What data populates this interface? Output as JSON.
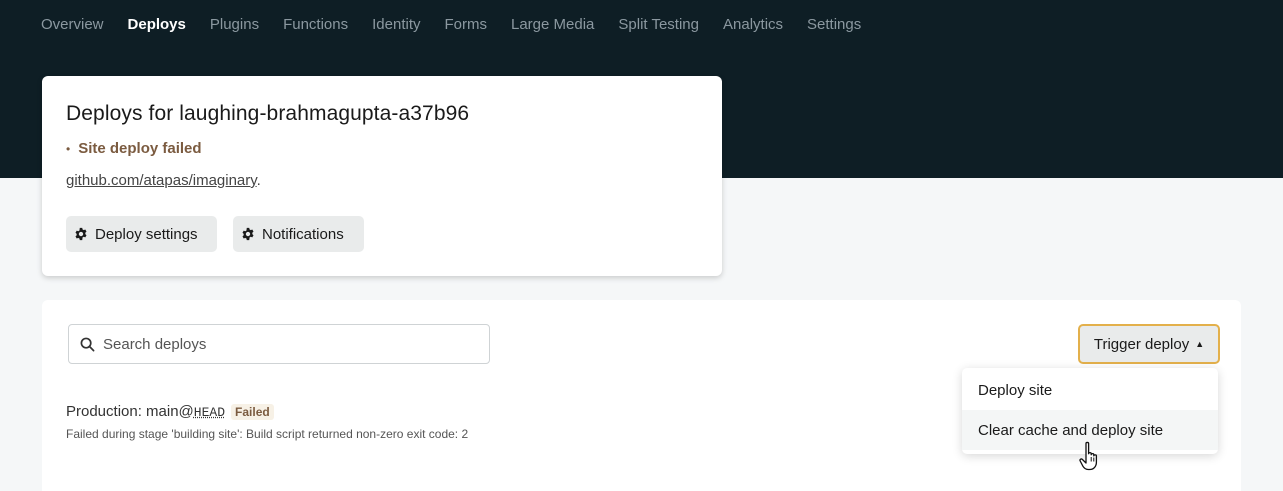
{
  "nav": {
    "items": [
      {
        "label": "Overview",
        "active": false
      },
      {
        "label": "Deploys",
        "active": true
      },
      {
        "label": "Plugins",
        "active": false
      },
      {
        "label": "Functions",
        "active": false
      },
      {
        "label": "Identity",
        "active": false
      },
      {
        "label": "Forms",
        "active": false
      },
      {
        "label": "Large Media",
        "active": false
      },
      {
        "label": "Split Testing",
        "active": false
      },
      {
        "label": "Analytics",
        "active": false
      },
      {
        "label": "Settings",
        "active": false
      }
    ]
  },
  "header": {
    "title": "Deploys for laughing-brahmagupta-a37b96",
    "status_bullet": "•",
    "status": "Site deploy failed",
    "repo_link": "github.com/atapas/imaginary",
    "repo_suffix": ".",
    "deploy_settings_label": "Deploy settings",
    "notifications_label": "Notifications"
  },
  "search": {
    "placeholder": "Search deploys",
    "value": ""
  },
  "trigger": {
    "label": "Trigger deploy",
    "caret": "▲"
  },
  "dropdown": {
    "items": [
      "Deploy site",
      "Clear cache and deploy site"
    ]
  },
  "deploy": {
    "prefix": "Production: main@",
    "ref": "HEAD",
    "badge": "Failed",
    "message": "Failed during stage 'building site': Build script returned non-zero exit code: 2"
  },
  "icons": {
    "gear": "gear-icon",
    "search": "search-icon",
    "cursor": "hand-pointer-icon"
  },
  "colors": {
    "hero_bg": "#0e1e25",
    "accent_border": "#e3b04b",
    "failed_text": "#7b5b40"
  }
}
